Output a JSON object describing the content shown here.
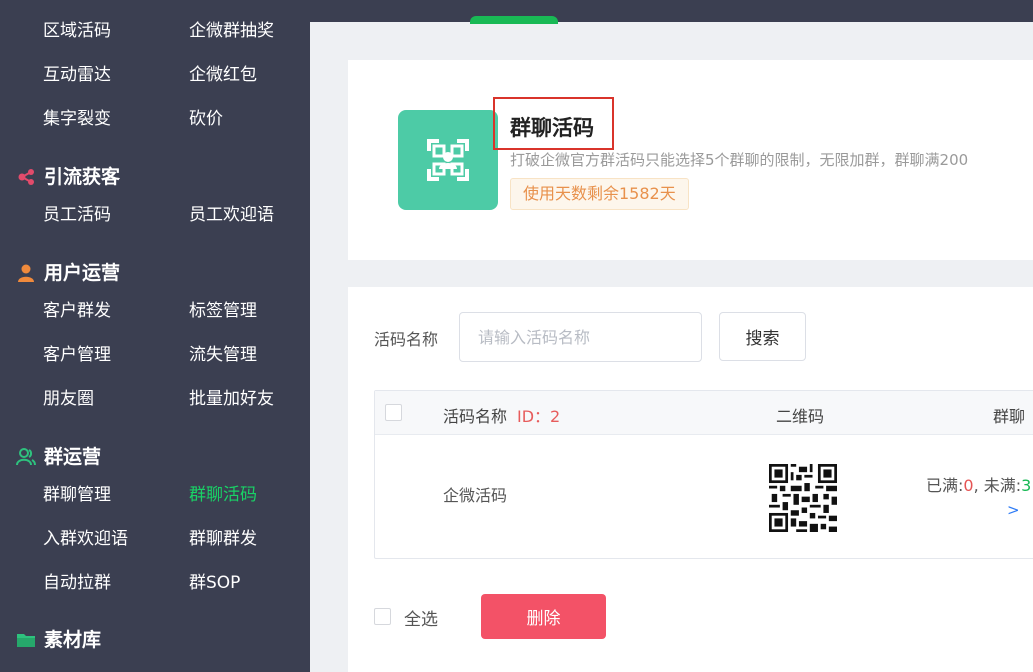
{
  "sidebar": {
    "top_rows": [
      {
        "left": "区域活码",
        "right": "企微群抽奖"
      },
      {
        "left": "互动雷达",
        "right": "企微红包"
      },
      {
        "left": "集字裂变",
        "right": "砍价"
      }
    ],
    "sections": [
      {
        "title": "引流获客",
        "icon": "share-icon",
        "icon_color": "#e24b6b",
        "items": [
          [
            "员工活码",
            "员工欢迎语"
          ]
        ]
      },
      {
        "title": "用户运营",
        "icon": "user-icon",
        "icon_color": "#f08a3c",
        "items": [
          [
            "客户群发",
            "标签管理"
          ],
          [
            "客户管理",
            "流失管理"
          ],
          [
            "朋友圈",
            "批量加好友"
          ]
        ]
      },
      {
        "title": "群运营",
        "icon": "group-icon",
        "icon_color": "#2ec27e",
        "items": [
          [
            "群聊管理",
            "群聊活码"
          ],
          [
            "入群欢迎语",
            "群聊群发"
          ],
          [
            "自动拉群",
            "群SOP"
          ]
        ]
      },
      {
        "title": "素材库",
        "icon": "folder-icon",
        "icon_color": "#2ec27e",
        "items": []
      }
    ],
    "active_item": "群聊活码"
  },
  "header_card": {
    "title": "群聊活码",
    "description": "打破企微官方群活码只能选择5个群聊的限制，无限加群，群聊满200",
    "badge": "使用天数剩余1582天"
  },
  "filter": {
    "label": "活码名称",
    "placeholder": "请输入活码名称",
    "search_button": "搜索"
  },
  "table": {
    "columns": {
      "name": "活码名称",
      "id_label": "ID：2",
      "qr": "二维码",
      "group": "群聊"
    },
    "rows": [
      {
        "name": "企微活码",
        "full_label": "已满:",
        "full_count": "0",
        "sep": ", 未满:",
        "notfull_count": "3",
        "more": ">"
      }
    ]
  },
  "footer": {
    "select_all": "全选",
    "delete_button": "删除"
  },
  "colors": {
    "sidebar_bg": "#3b3f51",
    "accent_green": "#19d266",
    "delete_red": "#f35267",
    "icon_teal": "#4dcba6"
  }
}
